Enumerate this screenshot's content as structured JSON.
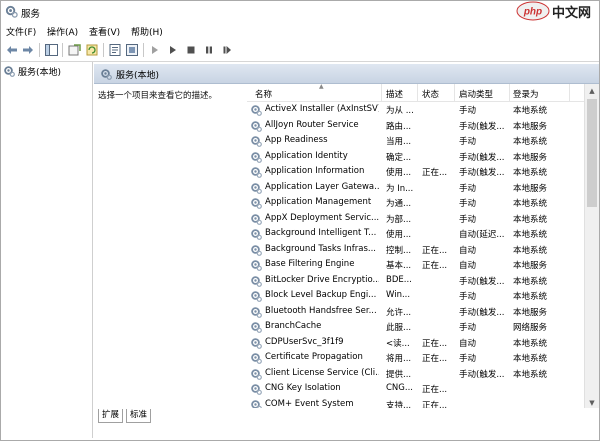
{
  "window": {
    "title": "服务"
  },
  "watermark": {
    "text": "中文网",
    "logo_text": "php"
  },
  "menu": [
    "文件(F)",
    "操作(A)",
    "查看(V)",
    "帮助(H)"
  ],
  "toolbar": {
    "icons": [
      "back-arrow-icon",
      "forward-arrow-icon",
      "show-hide-tree-icon",
      "export-list-icon",
      "refresh-icon",
      "properties-icon",
      "help-icon",
      "start-service-icon",
      "play-icon",
      "stop-icon",
      "pause-icon",
      "restart-icon"
    ]
  },
  "tree": {
    "root_label": "服务(本地)"
  },
  "panel": {
    "title": "服务(本地)",
    "desc": "选择一个项目来查看它的描述。"
  },
  "columns": [
    "名称",
    "描述",
    "状态",
    "启动类型",
    "登录为"
  ],
  "services": [
    {
      "name": "ActiveX Installer (AxInstSV)",
      "desc": "为从 ...",
      "status": "",
      "startup": "手动",
      "logon": "本地系统"
    },
    {
      "name": "AllJoyn Router Service",
      "desc": "路由...",
      "status": "",
      "startup": "手动(触发...",
      "logon": "本地服务"
    },
    {
      "name": "App Readiness",
      "desc": "当用...",
      "status": "",
      "startup": "手动",
      "logon": "本地系统"
    },
    {
      "name": "Application Identity",
      "desc": "确定...",
      "status": "",
      "startup": "手动(触发...",
      "logon": "本地服务"
    },
    {
      "name": "Application Information",
      "desc": "使用...",
      "status": "正在...",
      "startup": "手动(触发...",
      "logon": "本地系统"
    },
    {
      "name": "Application Layer Gatewa...",
      "desc": "为 In...",
      "status": "",
      "startup": "手动",
      "logon": "本地服务"
    },
    {
      "name": "Application Management",
      "desc": "为通...",
      "status": "",
      "startup": "手动",
      "logon": "本地系统"
    },
    {
      "name": "AppX Deployment Servic...",
      "desc": "为部...",
      "status": "",
      "startup": "手动",
      "logon": "本地系统"
    },
    {
      "name": "Background Intelligent T...",
      "desc": "使用...",
      "status": "",
      "startup": "自动(延迟...",
      "logon": "本地系统"
    },
    {
      "name": "Background Tasks Infras...",
      "desc": "控制...",
      "status": "正在...",
      "startup": "自动",
      "logon": "本地系统"
    },
    {
      "name": "Base Filtering Engine",
      "desc": "基本...",
      "status": "正在...",
      "startup": "自动",
      "logon": "本地服务"
    },
    {
      "name": "BitLocker Drive Encryptio...",
      "desc": "BDE...",
      "status": "",
      "startup": "手动(触发...",
      "logon": "本地系统"
    },
    {
      "name": "Block Level Backup Engi...",
      "desc": "Win...",
      "status": "",
      "startup": "手动",
      "logon": "本地系统"
    },
    {
      "name": "Bluetooth Handsfree Ser...",
      "desc": "允许...",
      "status": "",
      "startup": "手动(触发...",
      "logon": "本地服务"
    },
    {
      "name": "BranchCache",
      "desc": "此服...",
      "status": "",
      "startup": "手动",
      "logon": "网络服务"
    },
    {
      "name": "CDPUserSvc_3f1f9",
      "desc": "<读...",
      "status": "正在...",
      "startup": "自动",
      "logon": "本地系统"
    },
    {
      "name": "Certificate Propagation",
      "desc": "将用...",
      "status": "正在...",
      "startup": "手动",
      "logon": "本地系统"
    },
    {
      "name": "Client License Service (Cli...",
      "desc": "提供...",
      "status": "",
      "startup": "手动(触发...",
      "logon": "本地系统"
    },
    {
      "name": "CNG Key Isolation",
      "desc": "CNG...",
      "status": "正在...",
      "startup": "",
      "logon": ""
    },
    {
      "name": "COM+ Event System",
      "desc": "支持...",
      "status": "正在...",
      "startup": "",
      "logon": ""
    }
  ],
  "tabs": [
    "扩展",
    "标准"
  ]
}
